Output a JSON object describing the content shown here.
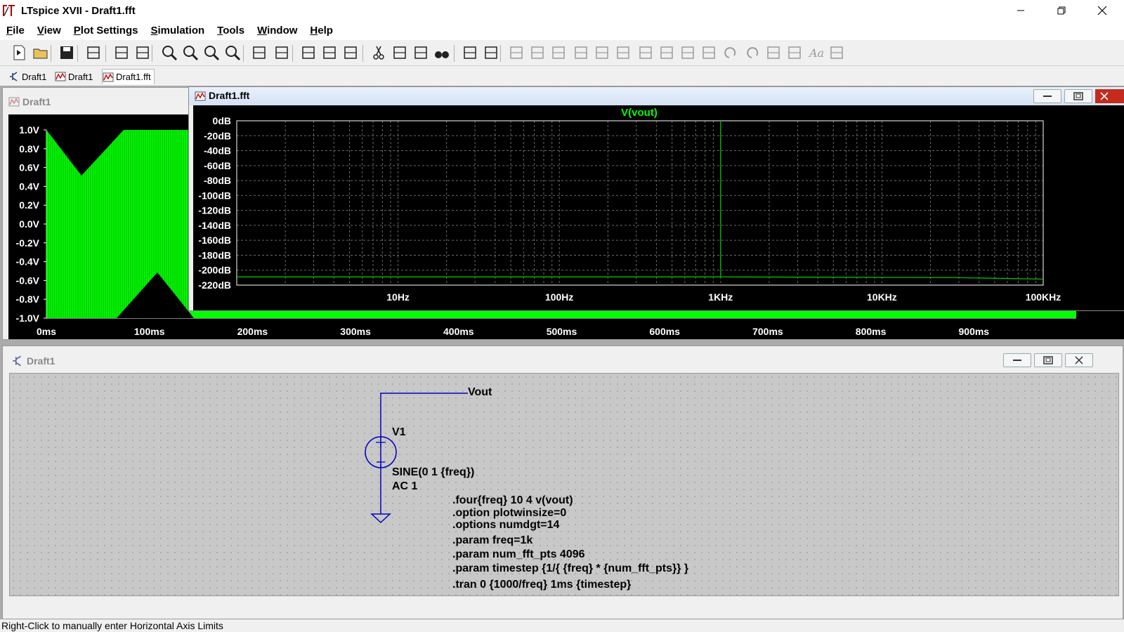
{
  "window": {
    "title": "LTspice XVII - Draft1.fft"
  },
  "menu": [
    "File",
    "View",
    "Plot Settings",
    "Simulation",
    "Tools",
    "Window",
    "Help"
  ],
  "toolbar_icons": [
    "new-schematic-icon",
    "open-icon",
    "save-icon",
    "control-panel-icon",
    "run-icon",
    "halt-icon",
    "zoom-in-icon",
    "zoom-full-icon",
    "zoom-out-icon",
    "zoom-cancel-icon",
    "autorange-icon",
    "mark-icon",
    "tile-horizontal-icon",
    "cascade-icon",
    "tile-vertical-icon",
    "cut-icon",
    "copy-icon",
    "paste-icon",
    "find-icon",
    "print-icon",
    "print-preview-icon",
    "wire-icon",
    "ground-icon",
    "label-icon",
    "resistor-icon",
    "capacitor-icon",
    "inductor-icon",
    "diode-icon",
    "component-icon",
    "move-icon",
    "drag-icon",
    "undo-icon",
    "redo-icon",
    "rotate-icon",
    "mirror-icon",
    "text-icon",
    "spice-directive-icon"
  ],
  "tabs": [
    {
      "label": "Draft1",
      "type": "schematic"
    },
    {
      "label": "Draft1",
      "type": "waveform"
    },
    {
      "label": "Draft1.fft",
      "type": "waveform"
    }
  ],
  "wave_window": {
    "title": "Draft1",
    "yticks": [
      "1.0V",
      "0.8V",
      "0.6V",
      "0.4V",
      "0.2V",
      "0.0V",
      "-0.2V",
      "-0.4V",
      "-0.6V",
      "-0.8V",
      "-1.0V"
    ],
    "xticks": [
      "0ms",
      "100ms",
      "200ms",
      "300ms",
      "400ms",
      "500ms",
      "600ms",
      "700ms",
      "800ms",
      "900ms"
    ],
    "trace_color": "#00ff00"
  },
  "fft_window": {
    "title": "Draft1.fft",
    "trace": "V(vout)",
    "trace_color": "#00c000"
  },
  "chart_data": {
    "type": "line",
    "title": "",
    "series": [
      {
        "name": "V(vout)",
        "x": [
          1,
          1000,
          1000,
          1000,
          30000,
          100000
        ],
        "values": [
          -209,
          -209,
          0,
          -209,
          -210,
          -212
        ]
      }
    ],
    "xlabel": "",
    "ylabel": "",
    "xscale": "log",
    "xlim": [
      1,
      100000
    ],
    "ylim": [
      -220,
      0
    ],
    "yticks": [
      "0dB",
      "-20dB",
      "-40dB",
      "-60dB",
      "-80dB",
      "-100dB",
      "-120dB",
      "-140dB",
      "-160dB",
      "-180dB",
      "-200dB",
      "-220dB"
    ],
    "xticks": [
      "10Hz",
      "100Hz",
      "1KHz",
      "10KHz",
      "100KHz"
    ],
    "grid": true
  },
  "schematic": {
    "title": "Draft1",
    "net_label": "Vout",
    "source_name": "V1",
    "source_value": "SINE(0 1 {freq})",
    "source_ac": "AC 1",
    "directives": [
      ".four{freq} 10 4 v(vout)",
      ".option plotwinsize=0",
      ".options numdgt=14",
      ".param freq=1k",
      ".param num_fft_pts 4096",
      ".param timestep {1/{ {freq} * {num_fft_pts}} }",
      ".tran 0 {1000/freq} 1ms {timestep}"
    ]
  },
  "status": "Right-Click to manually enter Horizontal Axis Limits"
}
